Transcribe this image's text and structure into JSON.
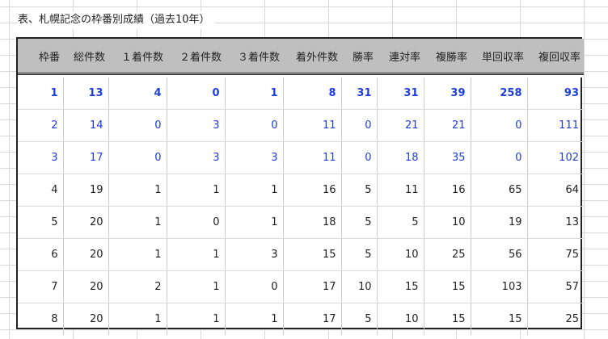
{
  "title": "表、札幌記念の枠番別成績（過去10年）",
  "columns": [
    "枠番",
    "総件数",
    "１着件数",
    "２着件数",
    "３着件数",
    "着外件数",
    "勝率",
    "連対率",
    "複勝率",
    "単回収率",
    "複回収率"
  ],
  "rows": [
    {
      "style": "bold",
      "cells": [
        "1",
        "13",
        "4",
        "0",
        "1",
        "8",
        "31",
        "31",
        "39",
        "258",
        "93"
      ]
    },
    {
      "style": "blue",
      "cells": [
        "2",
        "14",
        "0",
        "3",
        "0",
        "11",
        "0",
        "21",
        "21",
        "0",
        "111"
      ]
    },
    {
      "style": "blue",
      "cells": [
        "3",
        "17",
        "0",
        "3",
        "3",
        "11",
        "0",
        "18",
        "35",
        "0",
        "102"
      ]
    },
    {
      "style": "normal",
      "cells": [
        "4",
        "19",
        "1",
        "1",
        "1",
        "16",
        "5",
        "11",
        "16",
        "65",
        "64"
      ]
    },
    {
      "style": "normal",
      "cells": [
        "5",
        "20",
        "1",
        "0",
        "1",
        "18",
        "5",
        "5",
        "10",
        "19",
        "13"
      ]
    },
    {
      "style": "normal",
      "cells": [
        "6",
        "20",
        "1",
        "1",
        "3",
        "15",
        "5",
        "10",
        "25",
        "56",
        "75"
      ]
    },
    {
      "style": "normal",
      "cells": [
        "7",
        "20",
        "2",
        "1",
        "0",
        "17",
        "10",
        "15",
        "15",
        "103",
        "57"
      ]
    },
    {
      "style": "normal",
      "cells": [
        "8",
        "20",
        "1",
        "1",
        "1",
        "17",
        "5",
        "10",
        "15",
        "15",
        "25"
      ]
    }
  ],
  "colors": {
    "highlight_text": "#1f3fd6",
    "header_bg": "#bfbfbf",
    "grid": "#d9d9d9"
  }
}
